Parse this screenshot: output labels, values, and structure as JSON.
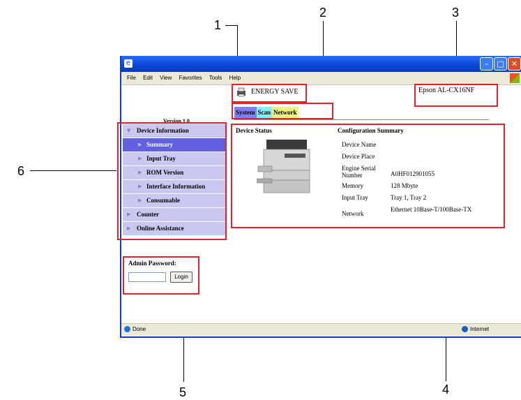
{
  "callouts": {
    "n1": "1",
    "n2": "2",
    "n3": "3",
    "n4": "4",
    "n5": "5",
    "n6": "6"
  },
  "browser": {
    "menu": [
      "File",
      "Edit",
      "View",
      "Favorites",
      "Tools",
      "Help"
    ],
    "status_left": "Done",
    "status_right": "Internet"
  },
  "page": {
    "version": "Version 1.0",
    "energy_save": "ENERGY SAVE",
    "model": "Epson AL-CX16NF",
    "tabs": {
      "system": "System",
      "scan": "Scan",
      "network": "Network"
    },
    "nav": {
      "device_information": "Device Information",
      "summary": "Summary",
      "input_tray": "Input Tray",
      "rom_version": "ROM Version",
      "interface_information": "Interface Information",
      "consumable": "Consumable",
      "counter": "Counter",
      "online_assistance": "Online Assistance"
    },
    "device_status": "Device Status",
    "configuration_summary": "Configuration Summary",
    "config": [
      {
        "key": "Device Name",
        "value": ""
      },
      {
        "key": "Device Place",
        "value": ""
      },
      {
        "key": "Engine Serial Number",
        "value": "A0HF012901055"
      },
      {
        "key": "Memory",
        "value": "128 Mbyte"
      },
      {
        "key": "Input Tray",
        "value": "Tray 1, Tray 2"
      },
      {
        "key": "Network",
        "value": "Ethernet 10Base-T/100Base-TX"
      }
    ],
    "admin_password": "Admin Password:",
    "login": "Login"
  },
  "colors": {
    "callout_box": "#e8202a",
    "nav_bg": "#c8c8f0",
    "nav_active": "#6060e0",
    "tab_system": "#8080f0",
    "tab_scan": "#80f0f0",
    "tab_network": "#f0f080"
  }
}
